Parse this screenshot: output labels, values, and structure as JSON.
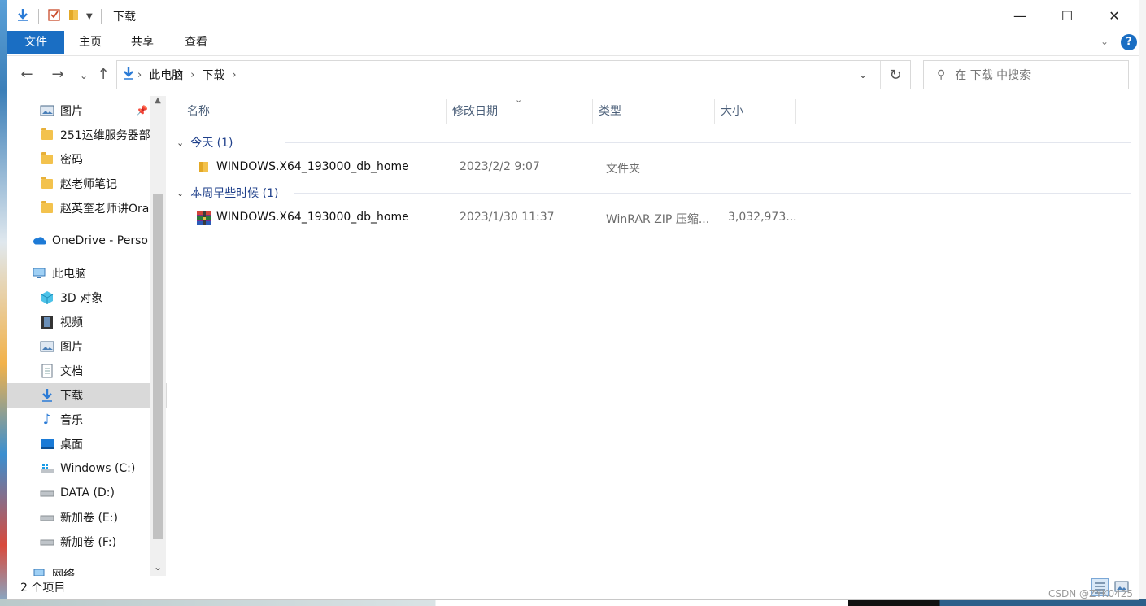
{
  "window": {
    "title": "下载"
  },
  "ribbon": {
    "tabs": [
      "文件",
      "主页",
      "共享",
      "查看"
    ]
  },
  "address": {
    "crumbs": [
      "此电脑",
      "下载"
    ]
  },
  "search": {
    "placeholder": "在 下载 中搜索"
  },
  "sidebar": {
    "items": [
      {
        "label": "图片",
        "icon": "pictures-icon",
        "pinned": true
      },
      {
        "label": "251运维服务器部",
        "icon": "folder-icon"
      },
      {
        "label": "密码",
        "icon": "folder-icon"
      },
      {
        "label": "赵老师笔记",
        "icon": "folder-icon"
      },
      {
        "label": "赵英奎老师讲Ora",
        "icon": "folder-icon"
      },
      {
        "label": "OneDrive - Perso",
        "icon": "onedrive-icon"
      },
      {
        "label": "此电脑",
        "icon": "this-pc-icon"
      },
      {
        "label": "3D 对象",
        "icon": "3d-objects-icon"
      },
      {
        "label": "视频",
        "icon": "videos-icon"
      },
      {
        "label": "图片",
        "icon": "pictures-icon"
      },
      {
        "label": "文档",
        "icon": "documents-icon"
      },
      {
        "label": "下载",
        "icon": "downloads-icon",
        "selected": true
      },
      {
        "label": "音乐",
        "icon": "music-icon"
      },
      {
        "label": "桌面",
        "icon": "desktop-icon"
      },
      {
        "label": "Windows (C:)",
        "icon": "windows-drive-icon"
      },
      {
        "label": "DATA (D:)",
        "icon": "drive-icon"
      },
      {
        "label": "新加卷 (E:)",
        "icon": "drive-icon"
      },
      {
        "label": "新加卷 (F:)",
        "icon": "drive-icon"
      },
      {
        "label": "网络",
        "icon": "network-icon"
      }
    ]
  },
  "columns": {
    "name": "名称",
    "date": "修改日期",
    "type": "类型",
    "size": "大小"
  },
  "groups": [
    {
      "label": "今天 (1)",
      "files": [
        {
          "name": "WINDOWS.X64_193000_db_home",
          "date": "2023/2/2 9:07",
          "type": "文件夹",
          "size": "",
          "icon": "folder-icon"
        }
      ]
    },
    {
      "label": "本周早些时候 (1)",
      "files": [
        {
          "name": "WINDOWS.X64_193000_db_home",
          "date": "2023/1/30 11:37",
          "type": "WinRAR ZIP 压缩...",
          "size": "3,032,973...",
          "icon": "winrar-archive-icon"
        }
      ]
    }
  ],
  "status": {
    "count": "2 个项目"
  },
  "watermark": "CSDN @ZYK0425",
  "colors": {
    "accent": "#1a6ec3",
    "selected": "#d9d9d9",
    "group": "#1e3f8a"
  }
}
